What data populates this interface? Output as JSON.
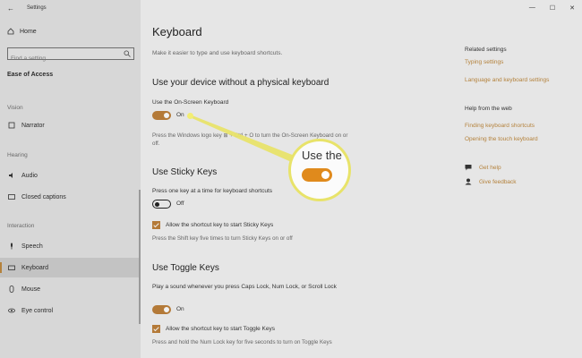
{
  "window": {
    "title": "Settings",
    "controls": [
      "—",
      "☐",
      "✕"
    ]
  },
  "sidebar": {
    "home": "Home",
    "search_placeholder": "Find a setting",
    "section": "Ease of Access",
    "groups": [
      "Vision",
      "Hearing",
      "Interaction"
    ],
    "items": [
      "Narrator",
      "Audio",
      "Closed captions",
      "Speech",
      "Keyboard",
      "Mouse",
      "Eye control"
    ],
    "active": "Keyboard"
  },
  "main": {
    "title": "Keyboard",
    "subtitle": "Make it easier to type and use keyboard shortcuts.",
    "osk": {
      "heading": "Use your device without a physical keyboard",
      "label": "Use the On-Screen Keyboard",
      "state": "On",
      "desc": "Press the Windows logo key ⊞ + Ctrl + O to turn the On-Screen Keyboard on or off."
    },
    "sticky": {
      "heading": "Use Sticky Keys",
      "label": "Press one key at a time for keyboard shortcuts",
      "state": "Off",
      "checkbox": "Allow the shortcut key to start Sticky Keys",
      "desc": "Press the Shift key five times to turn Sticky Keys on or off"
    },
    "toggle": {
      "heading": "Use Toggle Keys",
      "label": "Play a sound whenever you press Caps Lock, Num Lock, or Scroll Lock",
      "state": "On",
      "checkbox": "Allow the shortcut key to start Toggle Keys",
      "desc": "Press and hold the Num Lock key for five seconds to turn on Toggle Keys"
    }
  },
  "right": {
    "related_heading": "Related settings",
    "related_links": [
      "Typing settings",
      "Language and keyboard settings"
    ],
    "web_heading": "Help from the web",
    "web_links": [
      "Finding keyboard shortcuts",
      "Opening the touch keyboard"
    ],
    "help": "Get help",
    "feedback": "Give feedback"
  },
  "callout": {
    "text": "Use the"
  },
  "colors": {
    "accent": "#b4823c",
    "callout_toggle": "#e08a1c",
    "highlight": "#e8e36a"
  }
}
